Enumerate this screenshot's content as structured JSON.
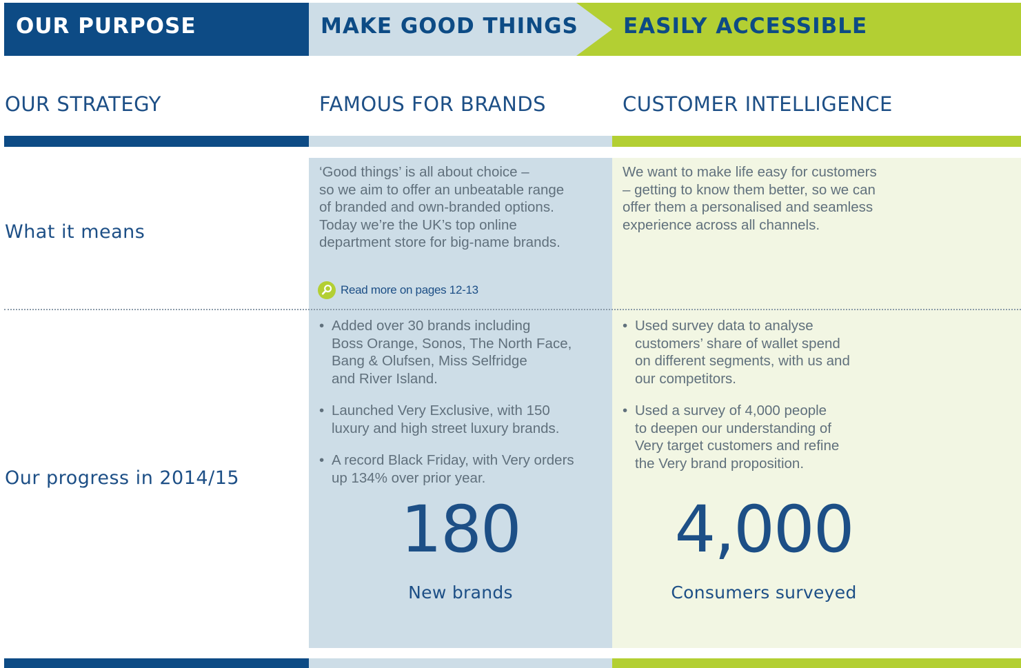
{
  "purpose": {
    "label": "OUR PURPOSE",
    "part1": "MAKE GOOD THINGS",
    "part2": "EASILY ACCESSIBLE"
  },
  "strategy": {
    "label": "OUR STRATEGY",
    "pillar1": "FAMOUS FOR BRANDS",
    "pillar2": "CUSTOMER INTELLIGENCE"
  },
  "rows": {
    "what_it_means": "What it means",
    "progress": "Our progress in 2014/15"
  },
  "brands": {
    "what_it_means": "‘Good things’ is all about choice –\nso we aim to offer an unbeatable range\nof branded and own-branded options.\nToday we’re the UK’s top online\ndepartment store for big-name brands.",
    "read_more": "Read more on pages 12-13",
    "bullets": [
      "Added over 30 brands including\nBoss Orange, Sonos, The North Face,\nBang & Olufsen, Miss Selfridge\nand River Island.",
      "Launched Very Exclusive, with 150\nluxury and high street luxury brands.",
      "A record Black Friday, with Very orders\nup 134% over prior year."
    ],
    "stat_value": "180",
    "stat_caption": "New brands"
  },
  "customer": {
    "what_it_means": "We want to make life easy for customers\n– getting to know them better, so we can\noffer them a personalised and seamless\nexperience across all channels.",
    "bullets": [
      "Used survey data to analyse\ncustomers’ share of wallet spend\non different segments, with us and\nour competitors.",
      "Used a survey of 4,000 people\nto deepen our understanding of\nVery target customers and refine\nthe Very brand proposition."
    ],
    "stat_value": "4,000",
    "stat_caption": "Consumers surveyed"
  },
  "icons": {
    "read_more": "magnifier-icon"
  },
  "colors": {
    "navy": "#0d4b85",
    "light_blue": "#cddde7",
    "lime": "#b3cf33",
    "pale_green": "#f2f6e3",
    "text_blue": "#1d4f86",
    "body_gray": "#60707c"
  }
}
